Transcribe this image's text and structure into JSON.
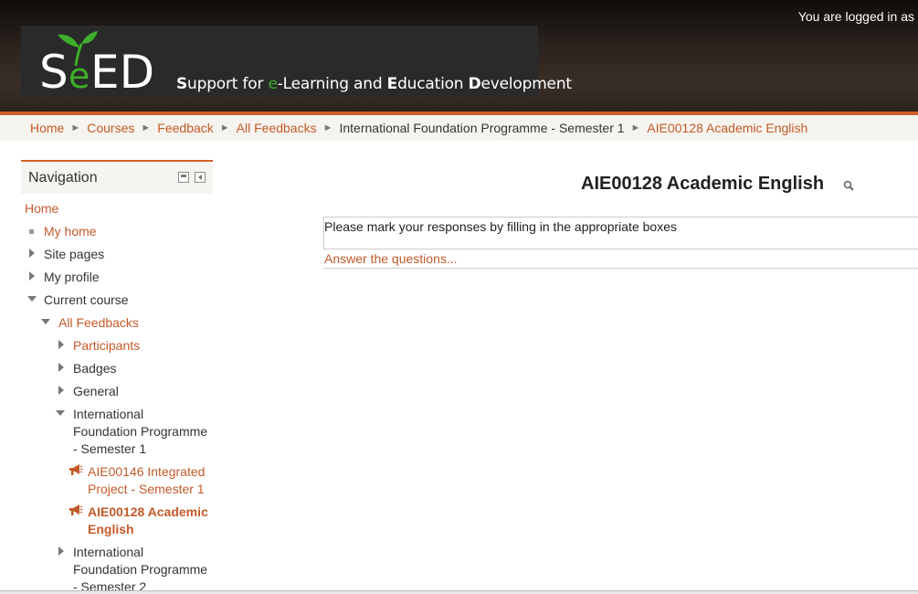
{
  "header": {
    "login_text": "You are logged in as",
    "logo": {
      "wordmark": "SeED",
      "tagline_parts": [
        {
          "text": "S",
          "cap": true
        },
        {
          "text": "upport for ",
          "cap": false
        },
        {
          "text": "e",
          "cap": false,
          "accent": true
        },
        {
          "text": "-Learning and ",
          "cap": false
        },
        {
          "text": "E",
          "cap": true
        },
        {
          "text": "ducation ",
          "cap": false
        },
        {
          "text": "D",
          "cap": true
        },
        {
          "text": "evelopment",
          "cap": false
        }
      ]
    }
  },
  "breadcrumb": {
    "items": [
      {
        "label": "Home",
        "link": true
      },
      {
        "label": "Courses",
        "link": true
      },
      {
        "label": "Feedback",
        "link": true
      },
      {
        "label": "All Feedbacks",
        "link": true
      },
      {
        "label": "International Foundation Programme - Semester 1",
        "link": false
      },
      {
        "label": "AIE00128 Academic English",
        "link": true
      }
    ],
    "separator": "►"
  },
  "navigation": {
    "title": "Navigation",
    "home": "Home",
    "my_home": "My home",
    "site_pages": "Site pages",
    "my_profile": "My profile",
    "current_course": "Current course",
    "all_feedbacks": "All Feedbacks",
    "participants": "Participants",
    "badges": "Badges",
    "general": "General",
    "ifp1_line1": "International",
    "ifp1_line2": "Foundation Programme",
    "ifp1_line3": "- Semester 1",
    "aie146_line1": "AIE00146 Integrated",
    "aie146_line2": "Project - Semester 1",
    "aie128_line1": "AIE00128 Academic",
    "aie128_line2": "English",
    "ifp2_line1": "International",
    "ifp2_line2": "Foundation Programme",
    "ifp2_line3": "- Semester 2"
  },
  "main": {
    "title": "AIE00128 Academic English",
    "intro": "Please mark your responses by filling in the appropriate boxes",
    "answer_link": "Answer the questions..."
  },
  "colors": {
    "accent": "#d35f2b",
    "link": "#c45a2a",
    "leaf_green": "#3fae2a",
    "header_dark": "#2a221d"
  }
}
